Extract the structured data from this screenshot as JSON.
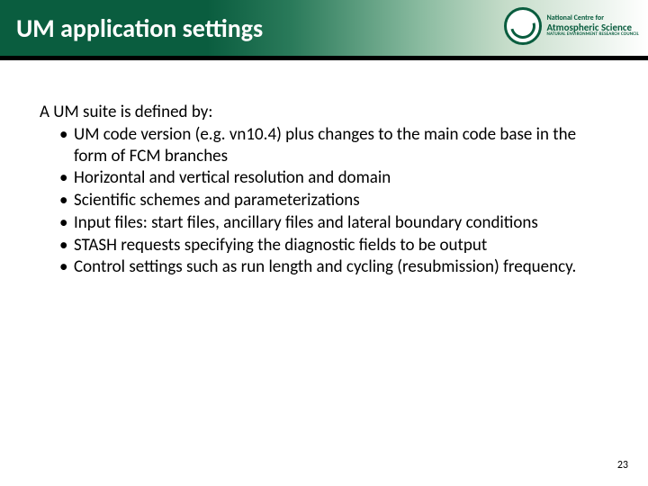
{
  "header": {
    "title": "UM application settings",
    "logo": {
      "line1": "National Centre for",
      "line2": "Atmospheric Science",
      "line3": "Natural Environment Research Council"
    }
  },
  "content": {
    "intro": "A UM suite is defined by:",
    "bullets": [
      "UM code version (e.g. vn10.4) plus changes to the main code base in the form of FCM branches",
      "Horizontal and vertical resolution and domain",
      "Scientific schemes and parameterizations",
      "Input files: start files, ancillary files and lateral boundary conditions",
      "STASH requests specifying the diagnostic fields to be output",
      "Control settings such as run length and cycling (resubmission) frequency."
    ]
  },
  "page_number": "23"
}
